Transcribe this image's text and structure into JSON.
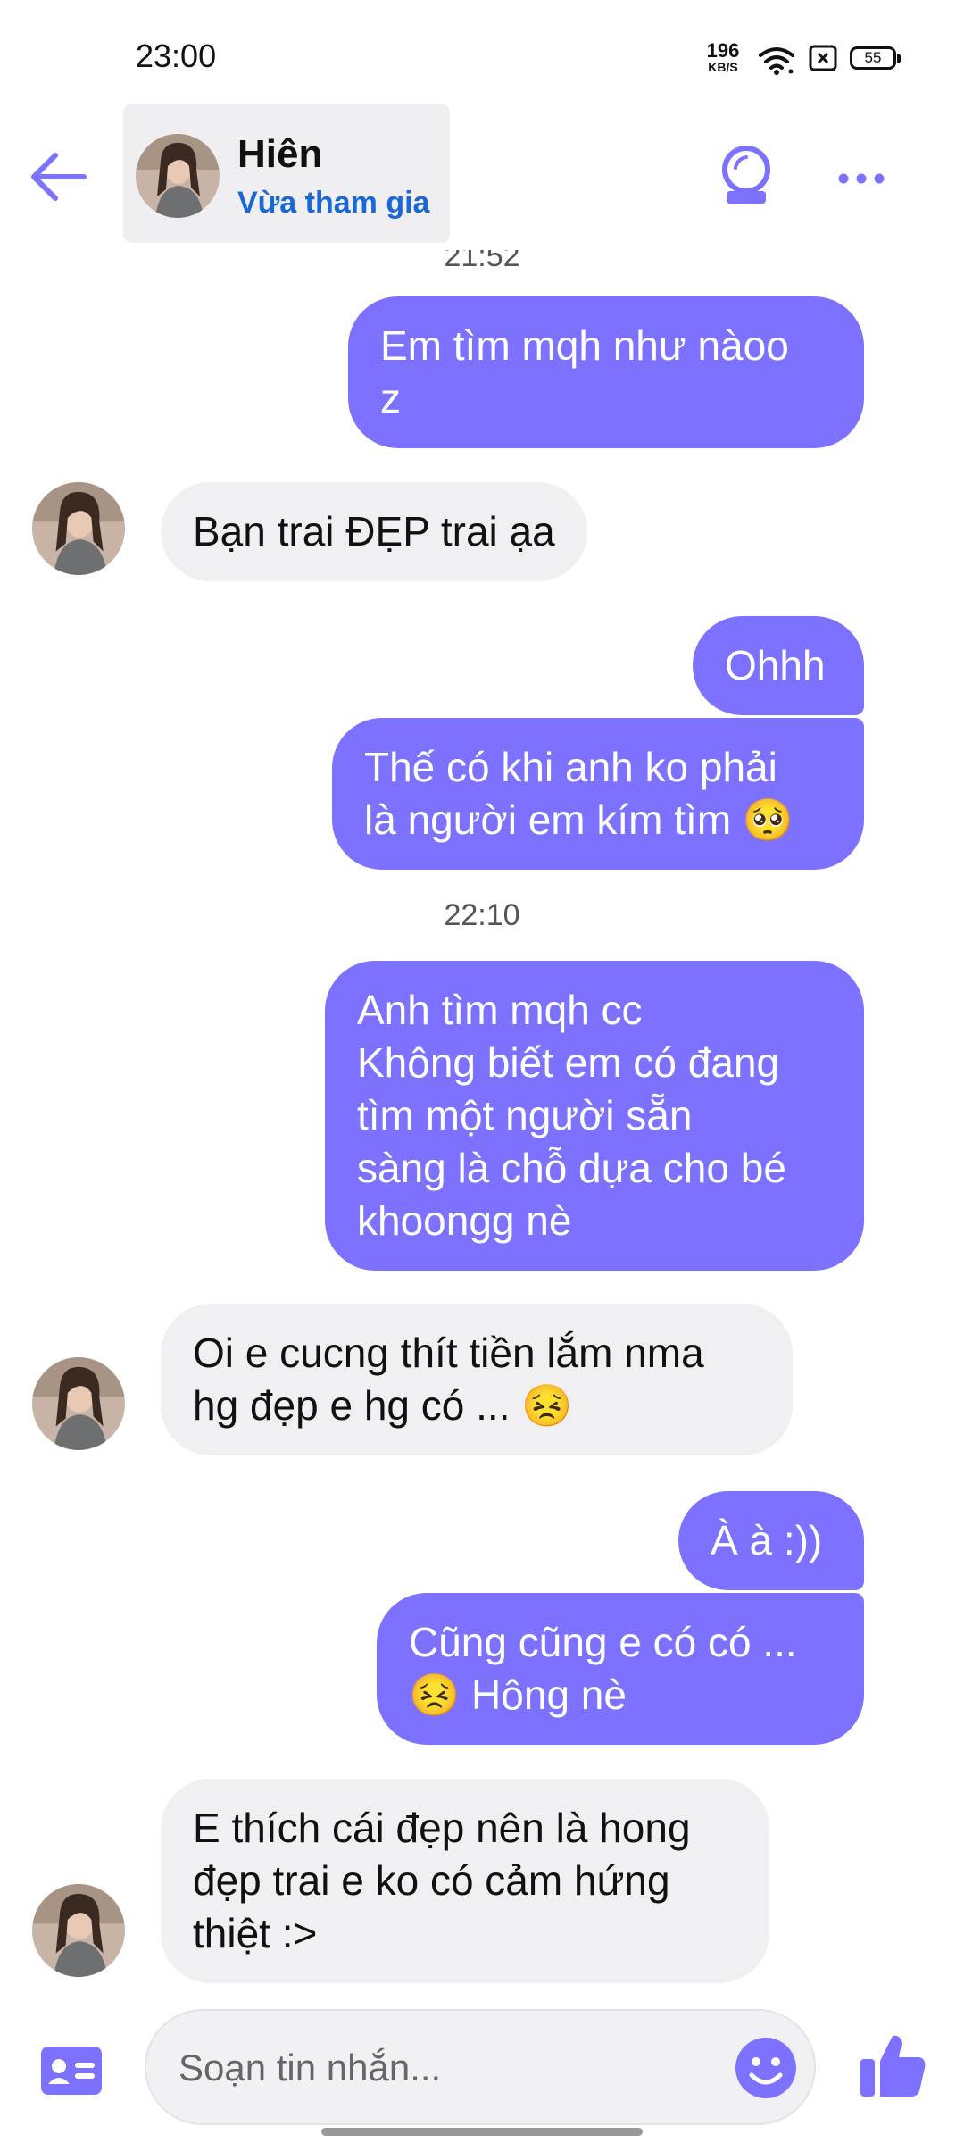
{
  "status": {
    "time": "23:00",
    "net_speed": "196",
    "net_unit": "KB/S",
    "battery": "55"
  },
  "header": {
    "contact_name": "Hiên",
    "contact_status": "Vừa tham gia"
  },
  "messages": [
    {
      "type": "time",
      "text": "21:52"
    },
    {
      "from": "me",
      "text": "Em tìm mqh như nàoo\nz"
    },
    {
      "from": "them",
      "text": "Bạn trai ĐẸP trai ạa"
    },
    {
      "from": "me",
      "text": "Ohhh"
    },
    {
      "from": "me",
      "text": "Thế có khi anh ko phải\nlà người em kím tìm 🥺"
    },
    {
      "type": "time",
      "text": "22:10"
    },
    {
      "from": "me",
      "text": "Anh tìm mqh cc\nKhông biết em có đang\ntìm một người sẵn\nsàng là chỗ dựa cho bé\nkhoongg nè"
    },
    {
      "from": "them",
      "text": "Oi e cucng thít tiền lắm nma\nhg đẹp e hg có ... 😣"
    },
    {
      "from": "me",
      "text": "À à :))"
    },
    {
      "from": "me",
      "text": "Cũng cũng e có có ...\n😣 Hông nè"
    },
    {
      "from": "them",
      "text": "E thích cái đẹp nên là hong\nđẹp trai e ko có cảm hứng\nthiệt :>"
    }
  ],
  "composer": {
    "placeholder": "Soạn tin nhắn..."
  },
  "colors": {
    "accent": "#7c72ff",
    "link": "#1a67d6",
    "incoming_bg": "#f0f0f3"
  },
  "icons": [
    "back-arrow-icon",
    "crystal-ball-icon",
    "more-icon",
    "contact-card-icon",
    "emoji-icon",
    "thumbs-up-icon"
  ]
}
